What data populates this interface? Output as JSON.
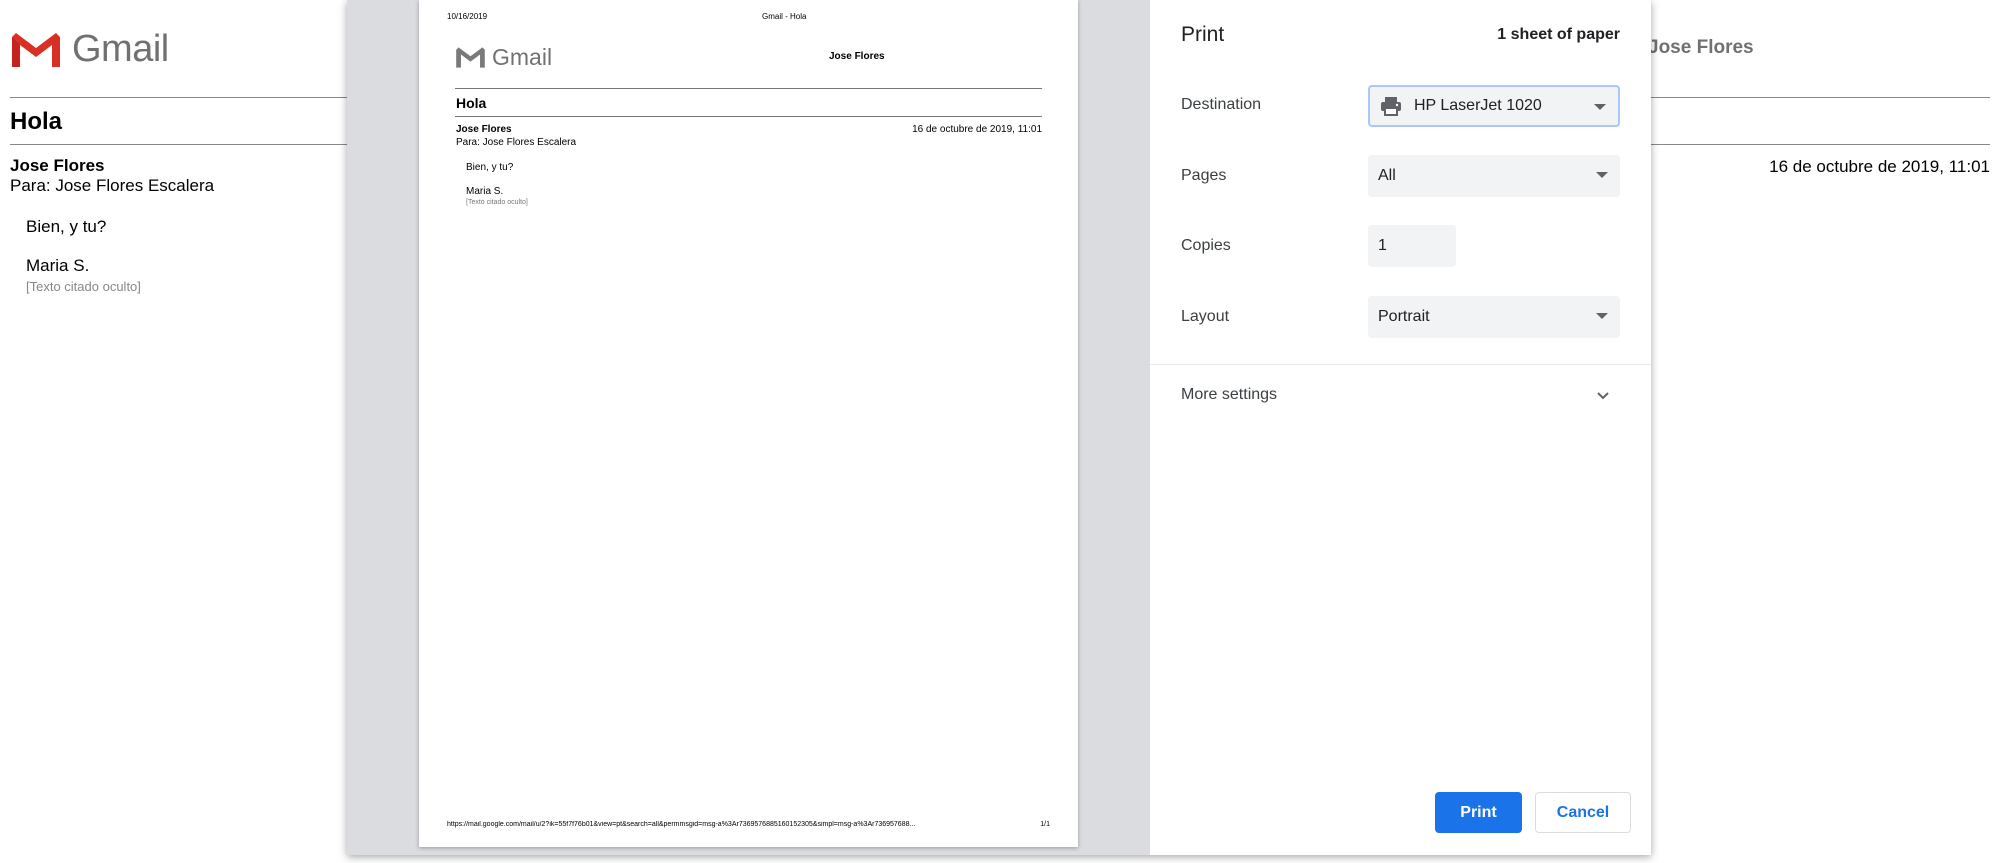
{
  "background": {
    "logo_text": "Gmail",
    "user_name": "Jose Flores",
    "subject": "Hola",
    "from": "Jose Flores",
    "to": "Para: Jose Flores Escalera",
    "date": "16 de octubre de 2019, 11:01",
    "body_line1": "Bien, y tu?",
    "body_line2": "Maria S.",
    "quoted_text": "[Texto citado oculto]"
  },
  "preview": {
    "header_date": "10/16/2019",
    "header_title": "Gmail - Hola",
    "logo_text": "Gmail",
    "user_name": "Jose Flores",
    "subject": "Hola",
    "from": "Jose Flores",
    "to": "Para: Jose Flores Escalera",
    "date": "16 de octubre de 2019, 11:01",
    "body_line1": "Bien, y tu?",
    "body_line2": "Maria S.",
    "quoted_text": "[Texto citado oculto]",
    "footer_url": "https://mail.google.com/mail/u/2?ik=55f7f76b01&view=pt&search=all&permmsgid=msg-a%3Ar7369576885160152305&simpl=msg-a%3Ar736957688...",
    "footer_page": "1/1"
  },
  "settings": {
    "title": "Print",
    "sheets": "1 sheet of paper",
    "destination_label": "Destination",
    "destination_value": "HP LaserJet 1020",
    "pages_label": "Pages",
    "pages_value": "All",
    "copies_label": "Copies",
    "copies_value": "1",
    "layout_label": "Layout",
    "layout_value": "Portrait",
    "more_settings": "More settings",
    "print_button": "Print",
    "cancel_button": "Cancel"
  },
  "colors": {
    "accent": "#1a73e8",
    "gmail_red": "#d93025",
    "preview_bg": "#dadce0"
  },
  "icons": {
    "gmail_logo": "gmail-m-logo",
    "printer": "printer-icon",
    "dropdown": "caret-down-icon",
    "expand": "chevron-down-icon"
  }
}
